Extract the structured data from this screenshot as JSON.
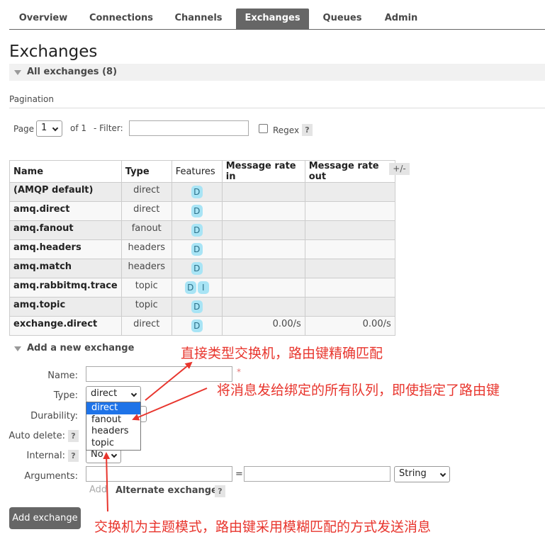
{
  "nav": {
    "tabs": [
      {
        "label": "Overview"
      },
      {
        "label": "Connections"
      },
      {
        "label": "Channels"
      },
      {
        "label": "Exchanges"
      },
      {
        "label": "Queues"
      },
      {
        "label": "Admin"
      }
    ],
    "active": "Exchanges"
  },
  "page": {
    "title": "Exchanges"
  },
  "all_exchanges": {
    "header": "All exchanges (8)"
  },
  "pagination": {
    "label": "Pagination",
    "page_label": "Page",
    "page_value": "1",
    "of_label": "of 1",
    "filter_label": "- Filter:",
    "filter_value": "",
    "regex_label": "Regex",
    "help": "?"
  },
  "table": {
    "columns": [
      "Name",
      "Type",
      "Features",
      "Message rate in",
      "Message rate out"
    ],
    "plus_minus": "+/-",
    "rows": [
      {
        "name": "(AMQP default)",
        "type": "direct",
        "features": [
          "D"
        ],
        "rate_in": "",
        "rate_out": ""
      },
      {
        "name": "amq.direct",
        "type": "direct",
        "features": [
          "D"
        ],
        "rate_in": "",
        "rate_out": ""
      },
      {
        "name": "amq.fanout",
        "type": "fanout",
        "features": [
          "D"
        ],
        "rate_in": "",
        "rate_out": ""
      },
      {
        "name": "amq.headers",
        "type": "headers",
        "features": [
          "D"
        ],
        "rate_in": "",
        "rate_out": ""
      },
      {
        "name": "amq.match",
        "type": "headers",
        "features": [
          "D"
        ],
        "rate_in": "",
        "rate_out": ""
      },
      {
        "name": "amq.rabbitmq.trace",
        "type": "topic",
        "features": [
          "D",
          "I"
        ],
        "rate_in": "",
        "rate_out": ""
      },
      {
        "name": "amq.topic",
        "type": "topic",
        "features": [
          "D"
        ],
        "rate_in": "",
        "rate_out": ""
      },
      {
        "name": "exchange.direct",
        "type": "direct",
        "features": [
          "D"
        ],
        "rate_in": "0.00/s",
        "rate_out": "0.00/s"
      }
    ]
  },
  "add_exchange": {
    "header": "Add a new exchange",
    "name_label": "Name:",
    "name_value": "",
    "required_mark": "*",
    "type_label": "Type:",
    "type_value": "direct",
    "type_options": [
      "direct",
      "fanout",
      "headers",
      "topic"
    ],
    "durability_label": "Durability:",
    "auto_delete_label": "Auto delete:",
    "internal_label": "Internal:",
    "internal_value": "No",
    "arguments_label": "Arguments:",
    "equals": "=",
    "arg_type_value": "String",
    "add_link": "Add",
    "alternate_exchange": "Alternate exchange",
    "help": "?",
    "submit_label": "Add exchange"
  },
  "annotations": {
    "direct_note": "直接类型交换机，路由键精确匹配",
    "fanout_note": "将消息发给绑定的所有队列，即使指定了路由键",
    "topic_note": "交换机为主题模式，路由键采用模糊匹配的方式发送消息",
    "color": "#e8352d"
  },
  "colors": {
    "active_tab": "#666666",
    "badge": "#a8e4f5",
    "dropdown_selected": "#1e73e8"
  }
}
